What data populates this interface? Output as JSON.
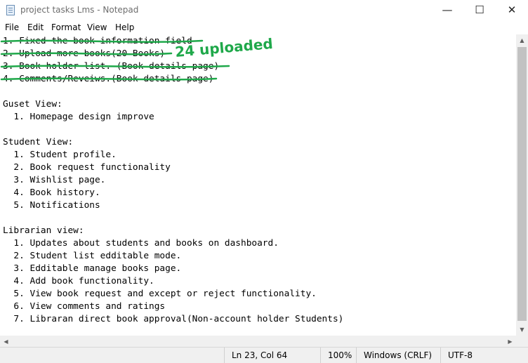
{
  "window": {
    "title": "project tasks Lms - Notepad",
    "minimize_glyph": "—",
    "maximize_glyph": "☐",
    "close_glyph": "✕"
  },
  "menu": [
    "File",
    "Edit",
    "Format",
    "View",
    "Help"
  ],
  "document": {
    "lines": [
      "1. Fixed the book information field",
      "2. Upload more books(20 Books)",
      "3. Book holder list. (Book details page)",
      "4. Comments/Reveiws.(Book details page)",
      "",
      "Guset View:",
      "  1. Homepage design improve",
      "",
      "Student View:",
      "  1. Student profile.",
      "  2. Book request functionality",
      "  3. Wishlist page.",
      "  4. Book history.",
      "  5. Notifications",
      "",
      "Librarian view:",
      "  1. Updates about students and books on dashboard.",
      "  2. Student list edditable mode.",
      "  3. Edditable manage books page.",
      "  4. Add book functionality.",
      "  5. View book request and except or reject functionality.",
      "  6. View comments and ratings",
      "  7. Libraran direct book approval(Non-account holder Students)"
    ],
    "annotation": "24 uploaded",
    "annotation_color": "#1fa84a"
  },
  "status": {
    "position": "Ln 23, Col 64",
    "zoom": "100%",
    "line_ending": "Windows (CRLF)",
    "encoding": "UTF-8"
  }
}
